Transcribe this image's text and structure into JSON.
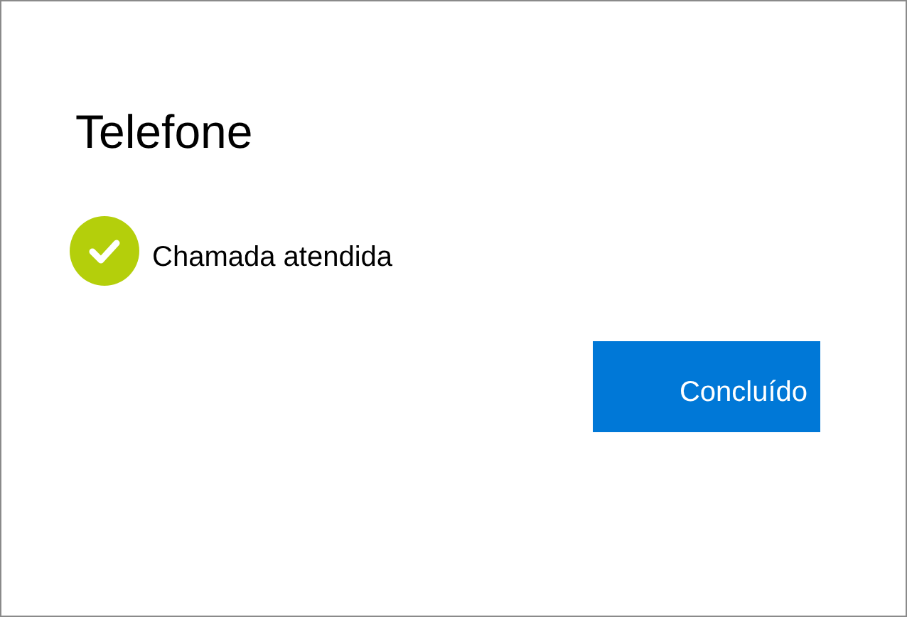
{
  "dialog": {
    "title": "Telefone"
  },
  "status": {
    "kind": "success",
    "label": "Chamada atendida"
  },
  "buttons": [
    {
      "label": "Concluído"
    }
  ]
}
